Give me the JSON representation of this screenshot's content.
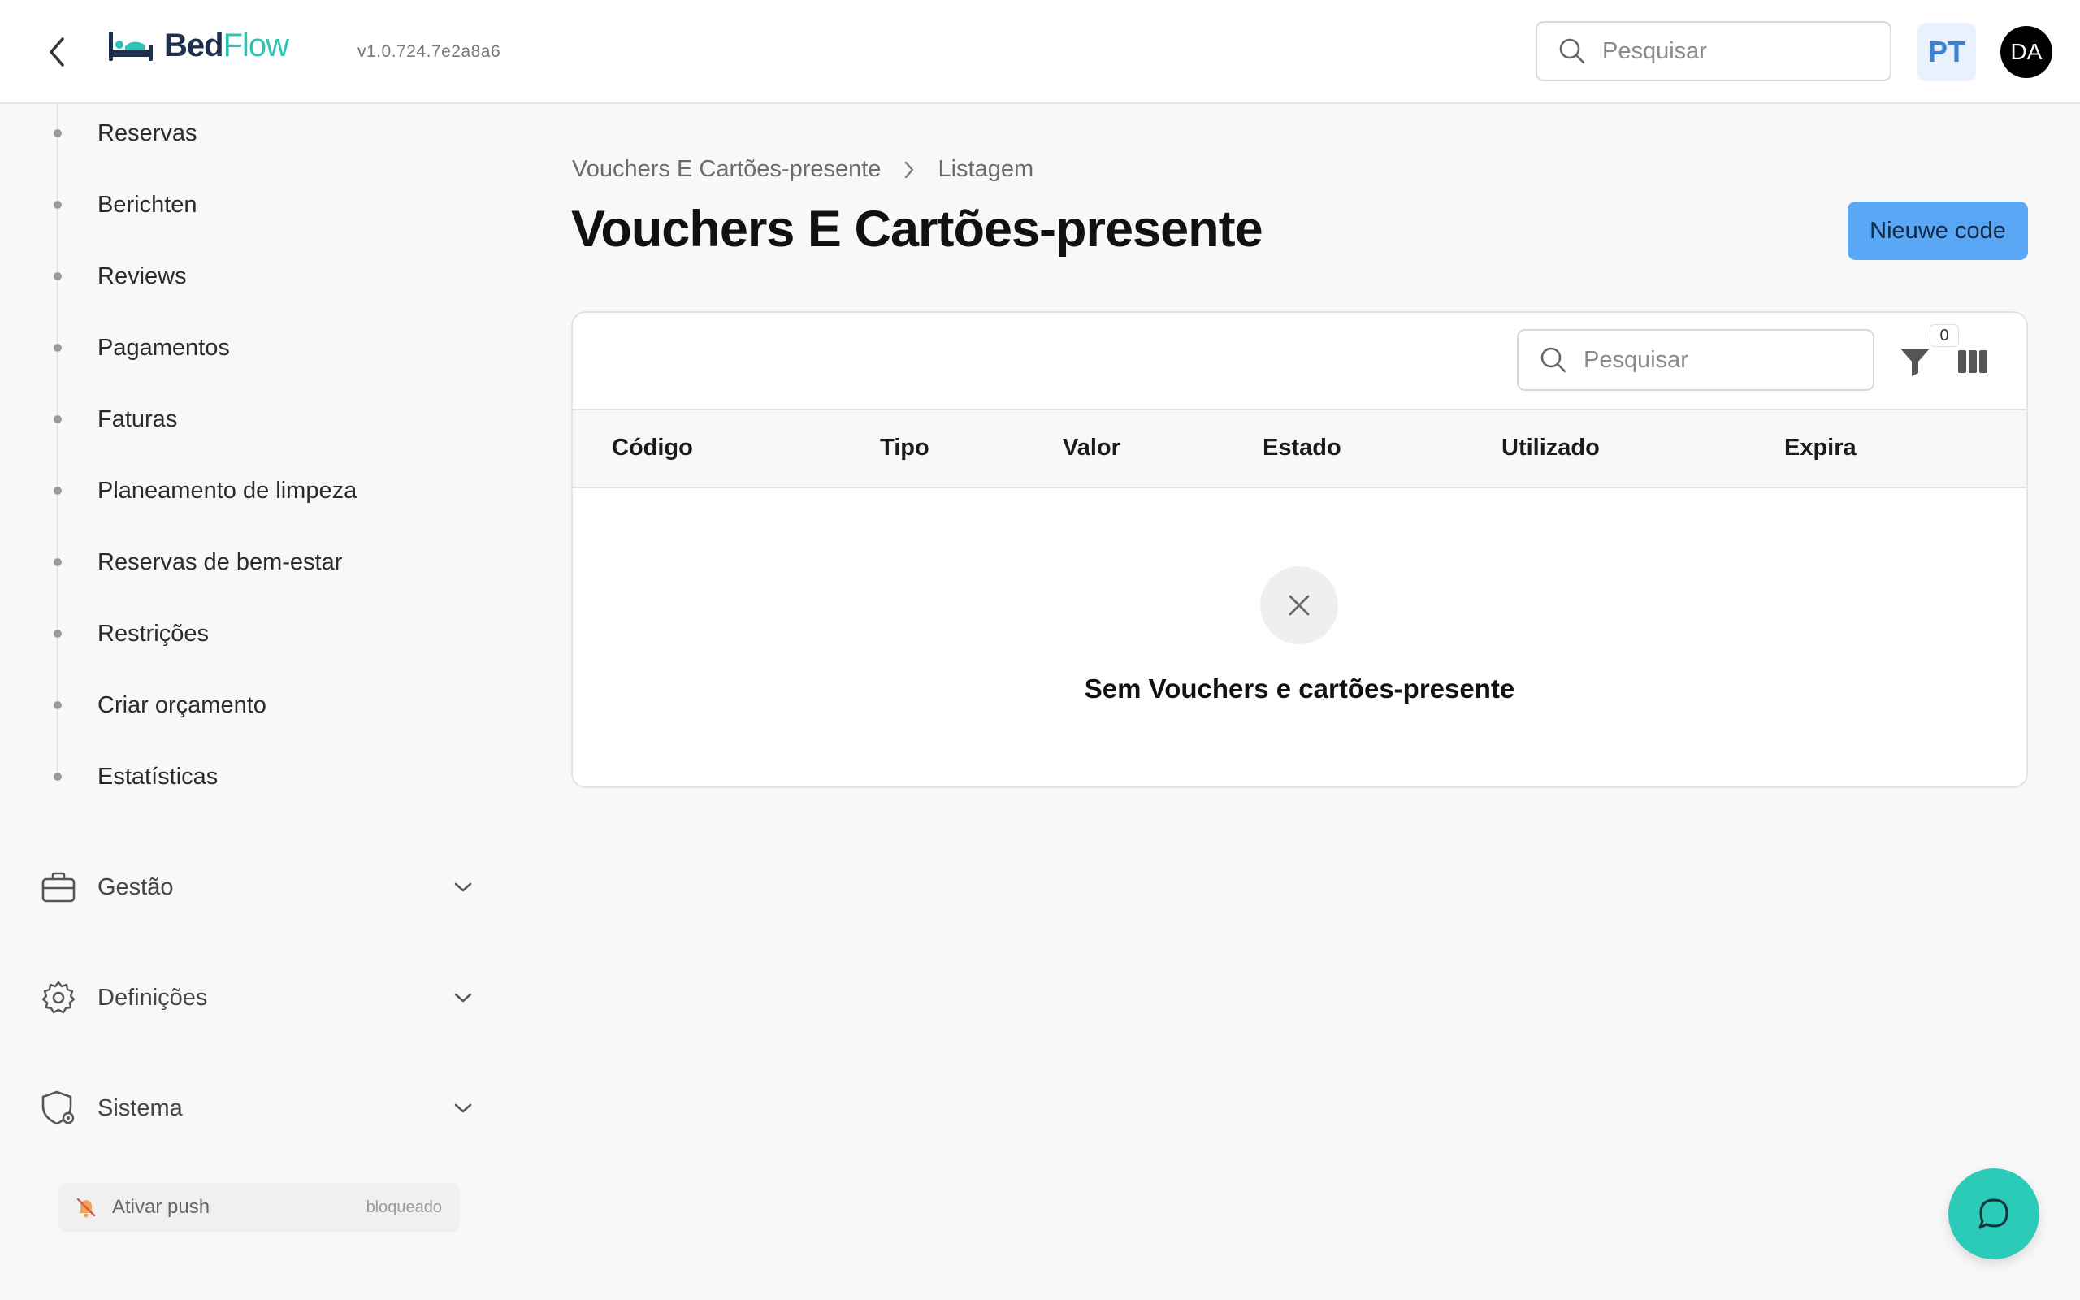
{
  "header": {
    "logo_part1": "Bed",
    "logo_part2": "Flow",
    "version": "v1.0.724.7e2a8a6",
    "search_placeholder": "Pesquisar",
    "language": "PT",
    "user_initials": "DA"
  },
  "sidebar": {
    "items": [
      {
        "label": "Reservas"
      },
      {
        "label": "Berichten"
      },
      {
        "label": "Reviews"
      },
      {
        "label": "Pagamentos"
      },
      {
        "label": "Faturas"
      },
      {
        "label": "Planeamento de limpeza"
      },
      {
        "label": "Reservas de bem-estar"
      },
      {
        "label": "Restrições"
      },
      {
        "label": "Criar orçamento"
      },
      {
        "label": "Estatísticas"
      }
    ],
    "groups": [
      {
        "label": "Gestão",
        "icon": "briefcase-icon"
      },
      {
        "label": "Definições",
        "icon": "gear-icon"
      },
      {
        "label": "Sistema",
        "icon": "shield-gear-icon"
      }
    ],
    "push": {
      "label": "Ativar push",
      "state": "bloqueado"
    }
  },
  "main": {
    "breadcrumb": [
      "Vouchers E Cartões-presente",
      "Listagem"
    ],
    "title": "Vouchers E Cartões-presente",
    "new_button": "Nieuwe code",
    "table": {
      "search_placeholder": "Pesquisar",
      "filter_count": "0",
      "columns": [
        "Código",
        "Tipo",
        "Valor",
        "Estado",
        "Utilizado",
        "Expira"
      ],
      "empty_text": "Sem Vouchers e cartões-presente"
    }
  },
  "colors": {
    "accent_teal": "#2ccab8",
    "primary_button": "#5aa7f5",
    "logo_navy": "#1e2f4d"
  }
}
